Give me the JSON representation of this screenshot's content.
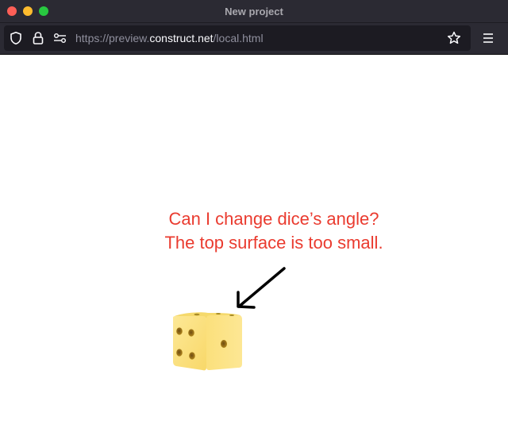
{
  "window": {
    "title": "New project",
    "buttons": [
      "close",
      "minimize",
      "maximize"
    ]
  },
  "toolbar": {
    "url_prefix": "https://preview.",
    "url_host": "construct.net",
    "url_path": "/local.html",
    "icons": [
      "shield-icon",
      "lock-icon",
      "permissions-icon",
      "bookmark-star-icon",
      "menu-icon"
    ]
  },
  "page": {
    "note_line1": "Can I change dice’s angle?",
    "note_line2": "The top surface is too small.",
    "note_color": "#ea3b2f",
    "dice_color": "#fde48a",
    "dice_pips_visible": {
      "front": 4,
      "side": 1
    }
  }
}
